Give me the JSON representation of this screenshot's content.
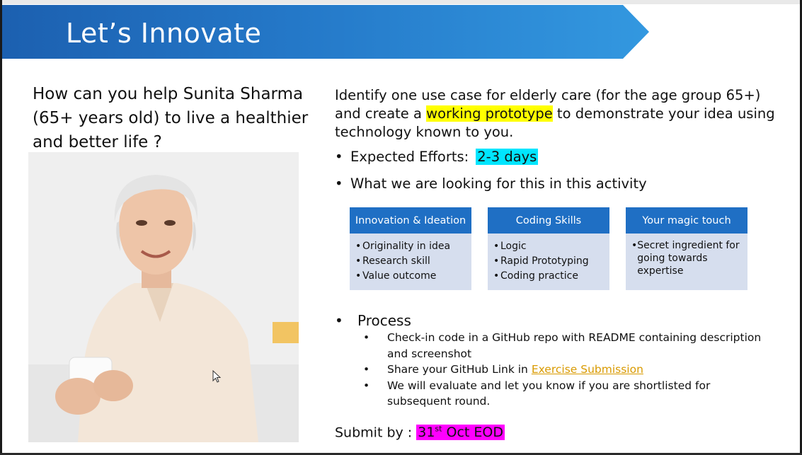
{
  "slide": {
    "title": "Let’s Innovate",
    "question": "How can you help Sunita Sharma (65+ years old) to live a healthier and better life ?",
    "intro": {
      "before": "Identify one use case for elderly care (for the age group 65+) and create a ",
      "highlight": "working prototype",
      "after": " to demonstrate your idea using technology known to you."
    },
    "efforts": {
      "label": "Expected Efforts:",
      "value": "2-3 days"
    },
    "looking_for": "What we are looking for this in this activity",
    "cards": [
      {
        "title": "Innovation & Ideation",
        "items": [
          "Originality in idea",
          "Research skill",
          "Value outcome"
        ]
      },
      {
        "title": "Coding Skills",
        "items": [
          "Logic",
          "Rapid Prototyping",
          "Coding practice"
        ]
      },
      {
        "title": "Your magic touch",
        "items": [
          "Secret ingredient for going towards expertise"
        ]
      }
    ],
    "process": {
      "label": "Process",
      "items": {
        "checkin": "Check-in code in a GitHub  repo with README containing description and screenshot",
        "share_before": "Share your GitHub Link in ",
        "share_link": "Exercise Submission",
        "evaluate": "We will evaluate and let you know if you are shortlisted for subsequent round."
      }
    },
    "submit": {
      "label": "Submit by :",
      "day": "31",
      "suffix": "st",
      "rest": " Oct EOD"
    },
    "bullet": "•",
    "colors": {
      "banner": "#2478c8",
      "highlight_yellow": "#ffff00",
      "highlight_cyan": "#00e5ff",
      "highlight_pink": "#ff00ff",
      "link": "#d99a00"
    },
    "image_alt": "elderly woman holding a cup"
  }
}
